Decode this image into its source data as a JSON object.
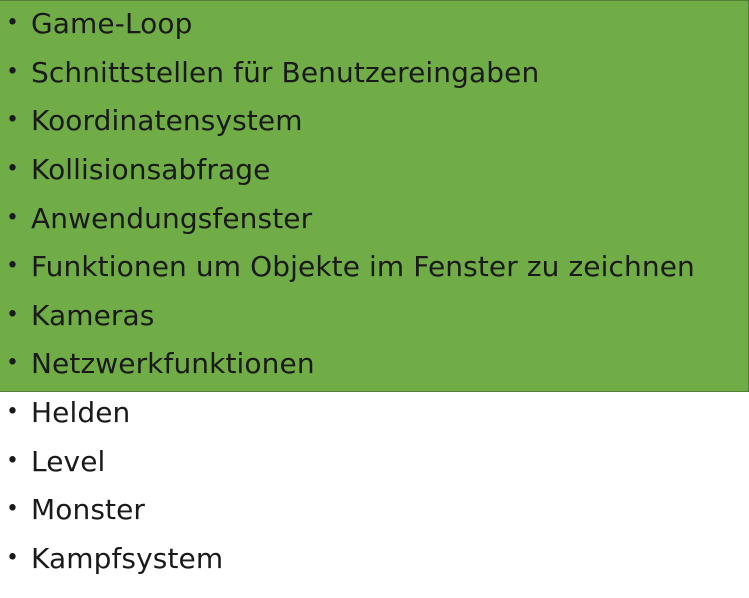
{
  "bullet_glyph": "•",
  "highlight_color": "#70ad47",
  "items": [
    {
      "label": "Game-Loop"
    },
    {
      "label": "Schnittstellen für Benutzereingaben"
    },
    {
      "label": "Koordinatensystem"
    },
    {
      "label": "Kollisionsabfrage"
    },
    {
      "label": "Anwendungsfenster"
    },
    {
      "label": "Funktionen um Objekte im Fenster zu zeichnen"
    },
    {
      "label": "Kameras"
    },
    {
      "label": "Netzwerkfunktionen"
    },
    {
      "label": "Helden"
    },
    {
      "label": "Level"
    },
    {
      "label": "Monster"
    },
    {
      "label": "Kampfsystem"
    }
  ]
}
